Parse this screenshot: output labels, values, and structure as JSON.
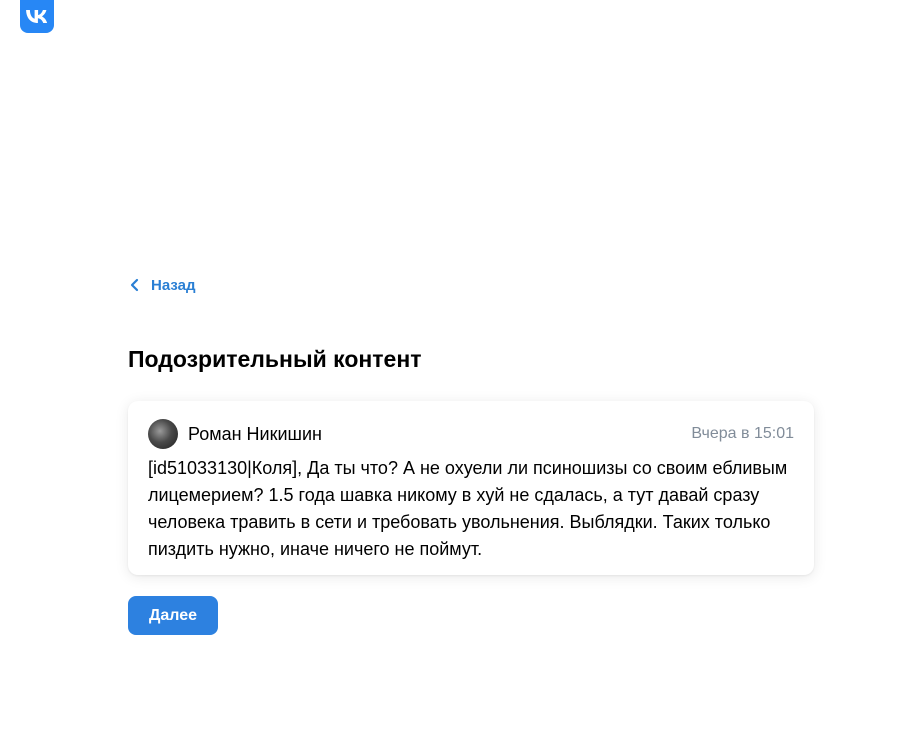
{
  "brand": {
    "logo_icon": "vk-logo-icon",
    "accent_color": "#2787f5"
  },
  "nav": {
    "back_label": "Назад",
    "back_icon": "chevron-left-icon"
  },
  "page": {
    "title": "Подозрительный контент"
  },
  "comment": {
    "author": "Роман Никишин",
    "timestamp": "Вчера в 15:01",
    "text": "[id51033130|Коля], Да ты что? А не охуели ли псиношизы со своим ебливым лицемерием? 1.5 года шавка никому в хуй не сдалась, а тут давай сразу человека травить в сети и требовать увольнения. Выблядки. Таких только пиздить нужно, иначе ничего не поймут."
  },
  "actions": {
    "next_label": "Далее",
    "button_color": "#2d81e0"
  }
}
